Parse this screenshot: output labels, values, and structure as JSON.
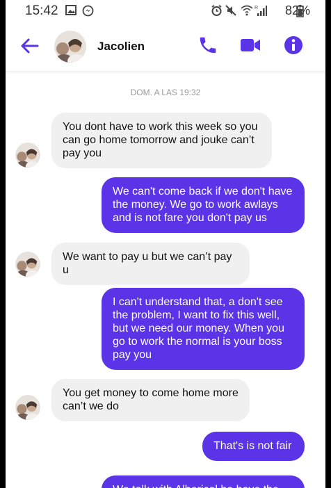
{
  "status_bar": {
    "time": "15:42",
    "battery": "82%"
  },
  "header": {
    "contact_name": "Jacolien",
    "accent_color": "#5a34e6"
  },
  "timestamp": "DOM. A LAS 19:32",
  "messages": [
    {
      "direction": "incoming",
      "text": "You dont have to work this week so you can go home tomorrow and jouke can’t pay you"
    },
    {
      "direction": "outgoing",
      "text": "We can't come back if we don't have the money. We go to work awlays and is not fare you don't pay us"
    },
    {
      "direction": "incoming",
      "text": "We want to pay u but we can’t pay u"
    },
    {
      "direction": "outgoing",
      "text": "I can't understand that, a don't see the problem, I want to fix this well, but we need our money. When you go to work the normal is your boss pay you"
    },
    {
      "direction": "incoming",
      "text": "You get money to come home more can’t we do"
    },
    {
      "direction": "outgoing",
      "text": "That's is not fair"
    },
    {
      "direction": "outgoing",
      "text": "We talk with Albericol ha have the"
    }
  ]
}
